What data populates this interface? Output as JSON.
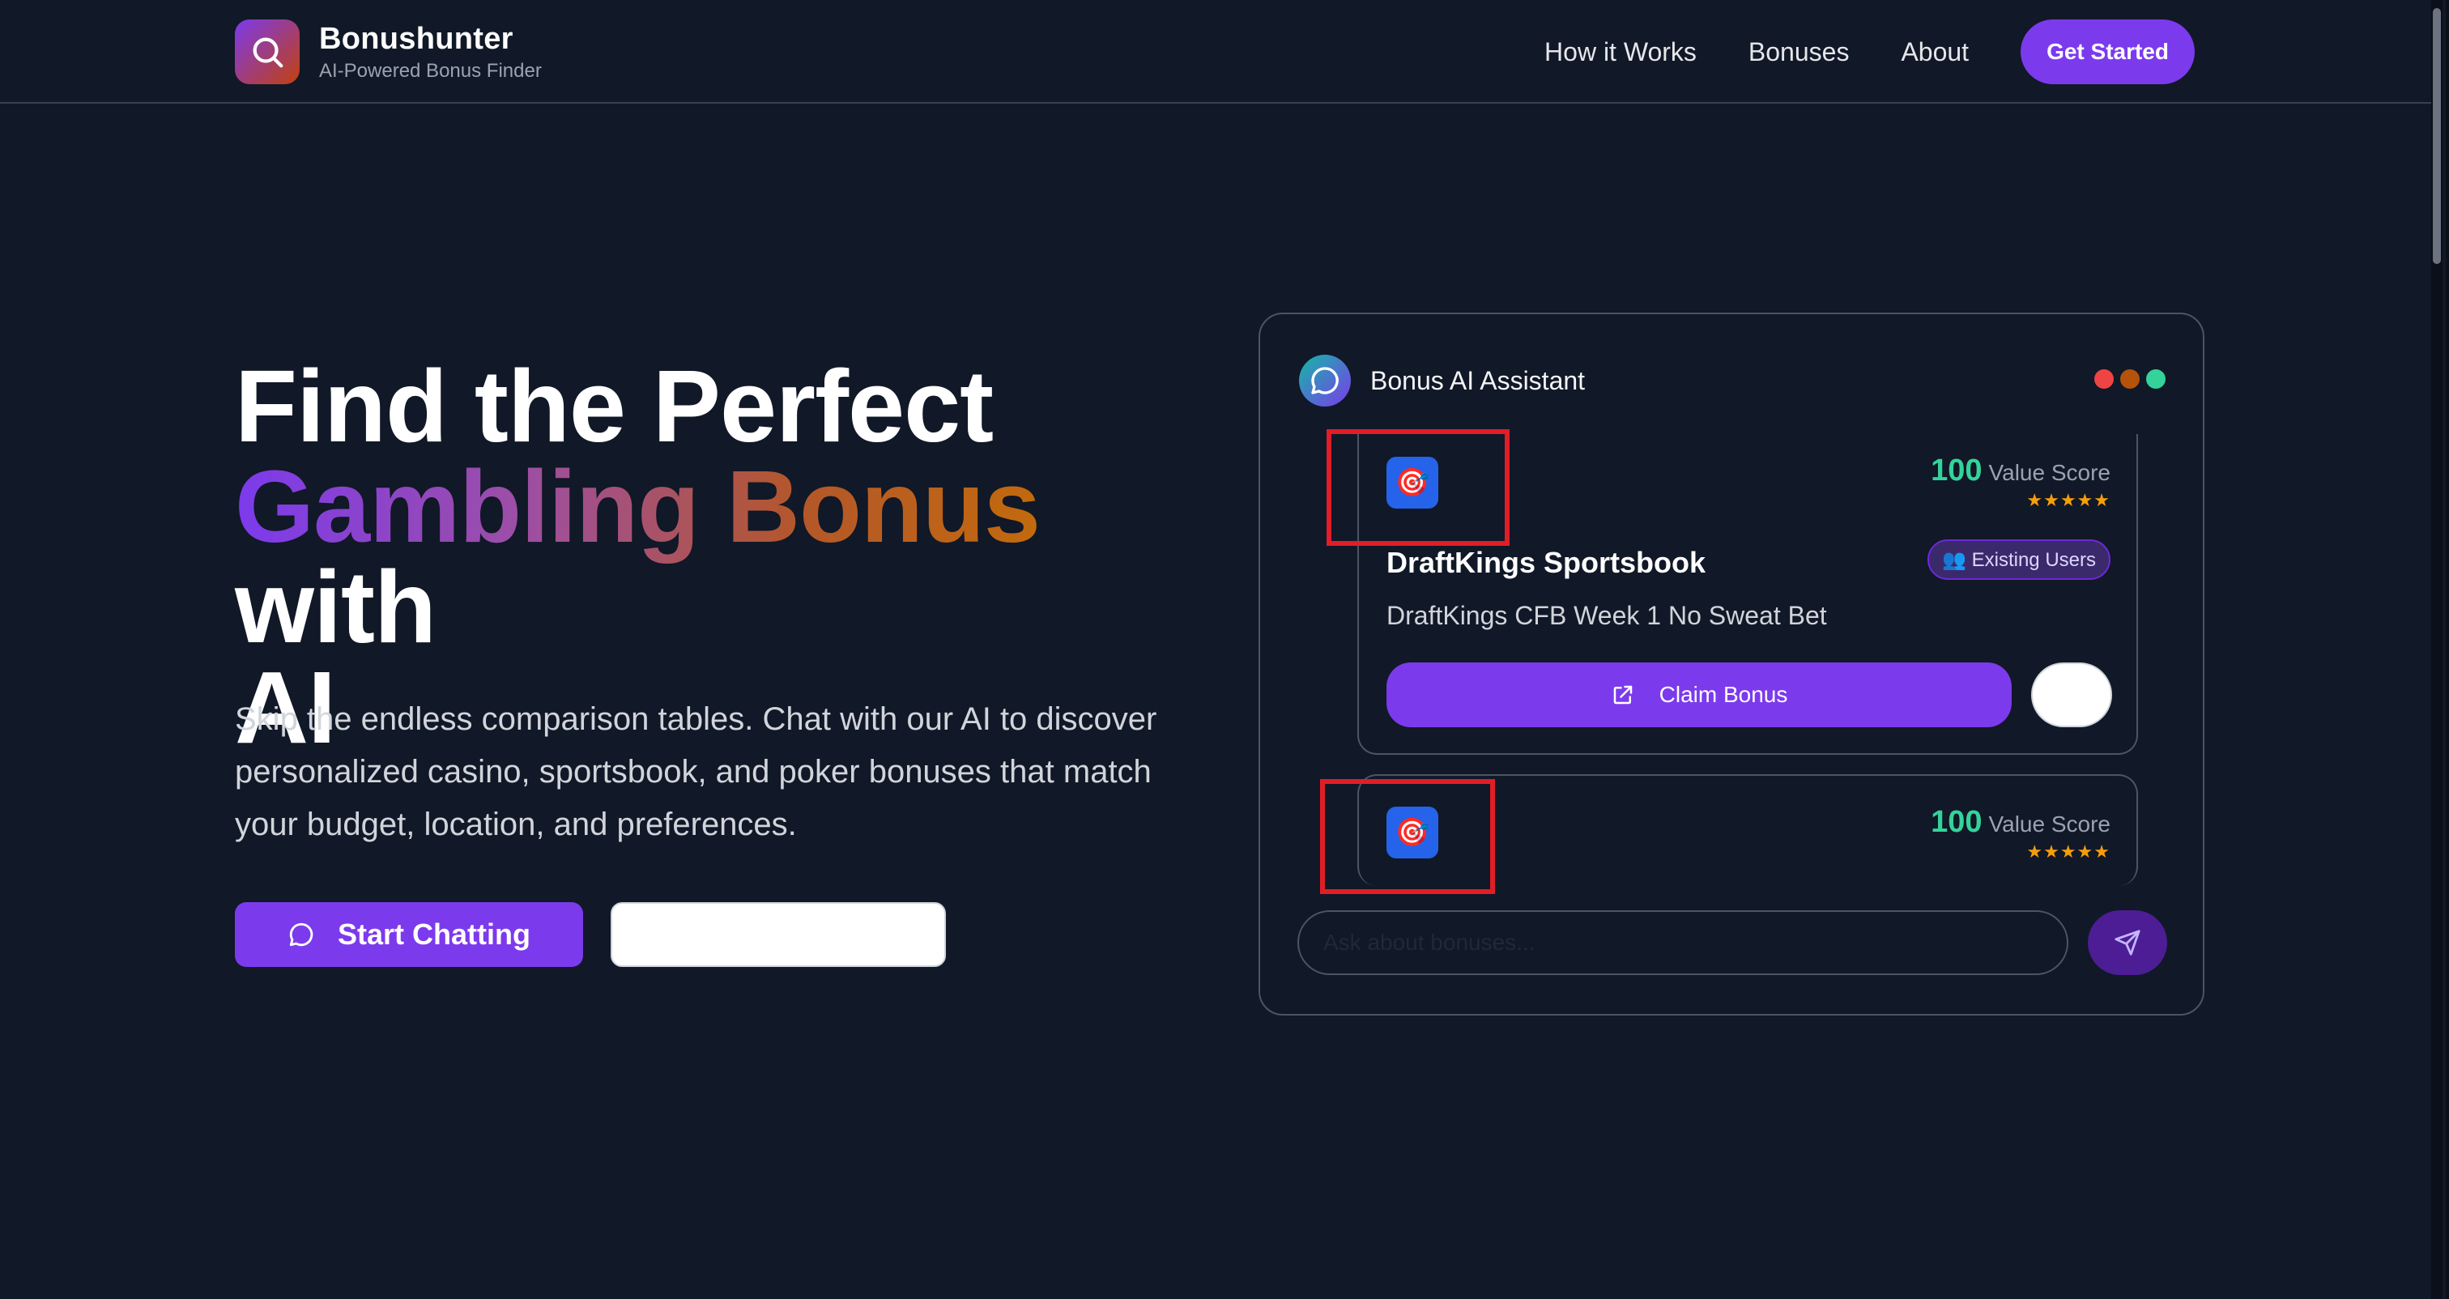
{
  "header": {
    "brand": "Bonushunter",
    "tagline": "AI-Powered Bonus Finder",
    "nav": [
      "How it Works",
      "Bonuses",
      "About"
    ],
    "cta": "Get Started"
  },
  "hero": {
    "title_line1": "Find the Perfect",
    "title_highlight": "Gambling Bonus",
    "title_with": "with",
    "title_line3": "AI",
    "description": "Skip the endless comparison tables. Chat with our AI to discover personalized casino, sportsbook, and poker bonuses that match your budget, location, and preferences.",
    "primary_button": "Start Chatting",
    "secondary_button": ""
  },
  "chat": {
    "assistant_name": "Bonus AI Assistant",
    "window_dots": [
      "#ef4444",
      "#b45309",
      "#34d399"
    ],
    "cards": [
      {
        "icon": "target-icon",
        "score": "100",
        "score_label": "Value Score",
        "stars": "★★★★★",
        "casino": "DraftKings Sportsbook",
        "badge": "👥 Existing Users",
        "bonus_title": "DraftKings CFB Week 1 No Sweat Bet",
        "claim_label": "Claim Bonus"
      },
      {
        "icon": "target-icon",
        "score": "100",
        "score_label": "Value Score",
        "stars": "★★★★★"
      }
    ],
    "input_placeholder": "Ask about bonuses..."
  },
  "colors": {
    "background": "#111827",
    "accent": "#7c3aed",
    "score": "#34d399",
    "star": "#f59e0b",
    "highlight": "#e11d27"
  }
}
